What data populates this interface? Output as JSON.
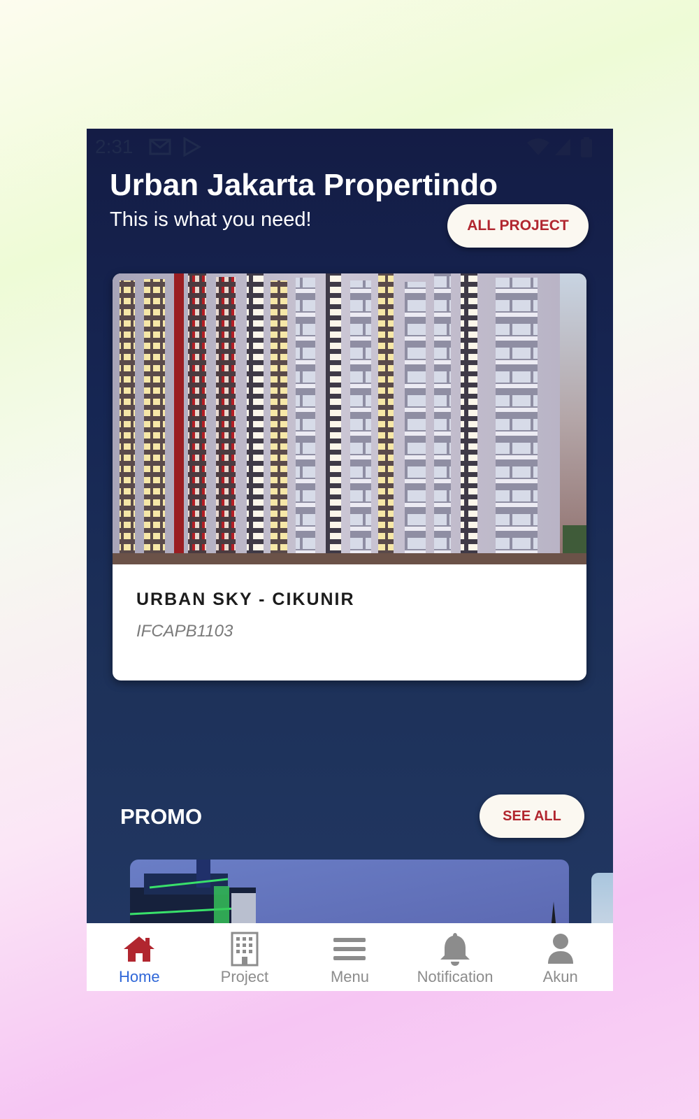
{
  "status_bar": {
    "time": "2:31"
  },
  "header": {
    "title": "Urban Jakarta Propertindo",
    "subtitle": "This is what you need!",
    "all_project_label": "ALL PROJECT"
  },
  "project_card": {
    "name": "URBAN SKY - CIKUNIR",
    "code": "IFCAPB1103",
    "image": "building-photo"
  },
  "promo": {
    "heading": "PROMO",
    "see_all_label": "SEE ALL"
  },
  "bottom_nav": {
    "items": [
      {
        "label": "Home",
        "icon": "home-icon",
        "active": true
      },
      {
        "label": "Project",
        "icon": "building-icon",
        "active": false
      },
      {
        "label": "Menu",
        "icon": "menu-icon",
        "active": false
      },
      {
        "label": "Notification",
        "icon": "bell-icon",
        "active": false
      },
      {
        "label": "Akun",
        "icon": "user-icon",
        "active": false
      }
    ]
  },
  "colors": {
    "accent_red": "#b1262f",
    "active_blue": "#2f67d8",
    "inactive_gray": "#8c8c8c",
    "header_navy": "#141c45"
  }
}
